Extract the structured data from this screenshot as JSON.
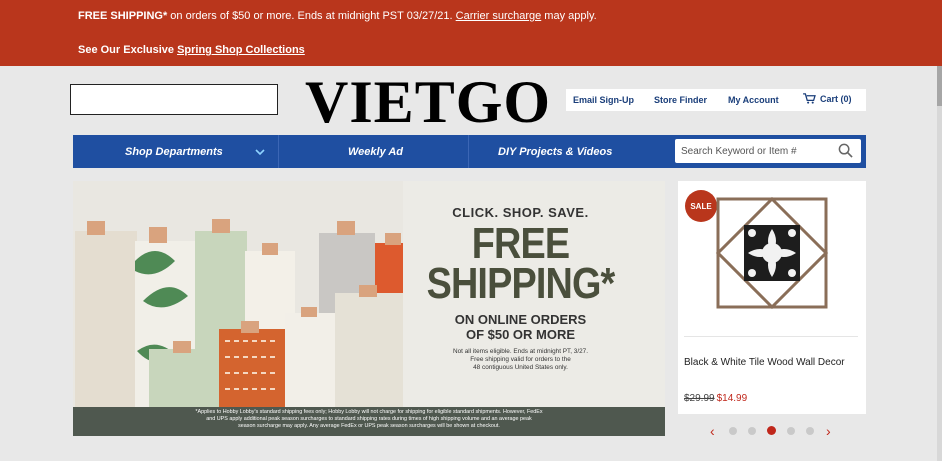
{
  "promo": {
    "bold": "FREE SHIPPING*",
    "text": " on orders of $50 or more. Ends at midnight PST 03/27/21. ",
    "surcharge_link": "Carrier surcharge",
    "tail": " may apply.",
    "line2_prefix": "See Our Exclusive ",
    "line2_link": "Spring Shop Collections"
  },
  "header": {
    "logo": "VIETGO",
    "links": {
      "email": "Email Sign-Up",
      "store": "Store Finder",
      "account": "My Account",
      "cart": "Cart (0)"
    }
  },
  "nav": {
    "shop": "Shop Departments",
    "weekly": "Weekly Ad",
    "diy": "DIY Projects & Videos",
    "search_placeholder": "Search Keyword or Item #"
  },
  "hero": {
    "line1": "CLICK. SHOP. SAVE.",
    "line2": "FREE",
    "line3": "SHIPPING*",
    "line4": "ON ONLINE ORDERS",
    "line5": "OF $50 OR MORE",
    "fine1": "Not all items eligible. Ends at midnight PT, 3/27.",
    "fine2": "Free shipping valid for orders to the",
    "fine3": "48 contiguous United States only.",
    "footer1": "*Applies to Hobby Lobby's standard shipping fees only; Hobby Lobby will not charge for shipping for eligible standard shipments. However, FedEx",
    "footer2": "and UPS apply additional peak season surcharges to standard shipping rates during times of high shipping volume and an average peak",
    "footer3": "season surcharge may apply. Any average FedEx or UPS peak season surcharges will be shown at checkout."
  },
  "product": {
    "badge": "SALE",
    "title": "Black & White Tile Wood Wall Decor",
    "old_price": "$29.99",
    "new_price": "$14.99"
  },
  "carousel": {
    "prev": "‹",
    "next": "›",
    "active_index": 3,
    "count": 5
  },
  "colors": {
    "promo_bg": "#b9361c",
    "nav_bg": "#1f4fa1",
    "accent_red": "#c0271b",
    "link_blue": "#1a3e7a"
  }
}
